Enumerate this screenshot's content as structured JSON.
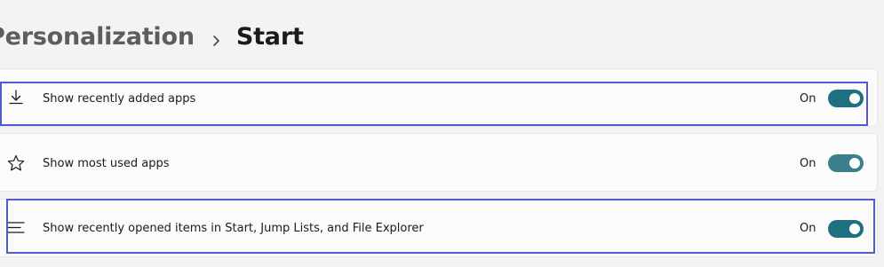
{
  "breadcrumb": {
    "parent": "Personalization",
    "current": "Start"
  },
  "settings": [
    {
      "label": "Show recently added apps",
      "state": "On",
      "icon": "download-icon",
      "on": true
    },
    {
      "label": "Show most used apps",
      "state": "On",
      "icon": "star-icon",
      "on": true
    },
    {
      "label": "Show recently opened items in Start, Jump Lists, and File Explorer",
      "state": "On",
      "icon": "list-icon",
      "on": true
    }
  ],
  "colors": {
    "toggle_on": "#1e6f7f",
    "highlight_border": "#4f5bd5",
    "page_background": "#f3f3f3"
  }
}
